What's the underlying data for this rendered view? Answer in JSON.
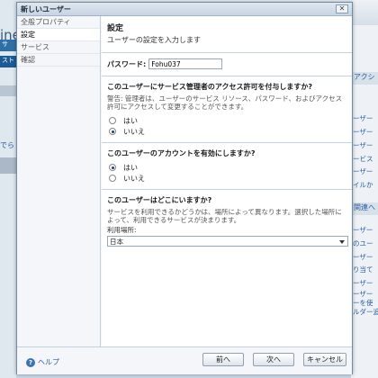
{
  "background": {
    "brand_fragment": "ine",
    "nav1_fragment": "サ",
    "nav2_fragment": "スト",
    "link_fragment": "でら",
    "right_header": "アクシ",
    "right_header2": "関連へ",
    "right_links": [
      "ーザー",
      "ーザー",
      "ーザー",
      "ービス",
      "ーザー",
      "イルか"
    ],
    "right_links2": [
      "ーザー",
      "のユー",
      "ーザー",
      "り当て",
      "ーザー",
      "ーザー",
      "ーを使",
      "ルダー追"
    ]
  },
  "dialog": {
    "title": "新しいユーザー",
    "close_label": "✕"
  },
  "sidebar": {
    "items": [
      {
        "label": "全般プロパティ"
      },
      {
        "label": "設定"
      },
      {
        "label": "サービス"
      },
      {
        "label": "確認"
      }
    ]
  },
  "content": {
    "title": "設定",
    "subtitle": "ユーザーの設定を入力します",
    "password_label": "パスワード:",
    "password_value": "Fohu037",
    "admin_question": "このユーザーにサービス管理者のアクセス許可を付与しますか?",
    "admin_warning": "警告: 管理者は、ユーザーのサービス リソース、パスワード、およびアクセス許可にアクセスして変更することができます。",
    "admin_yes": "はい",
    "admin_no": "いいえ",
    "enable_question": "このユーザーのアカウントを有効にしますか?",
    "enable_yes": "はい",
    "enable_no": "いいえ",
    "location_question": "このユーザーはどこにいますか?",
    "location_note": "サービスを利用できるかどうかは、場所によって異なります。選択した場所によって、利用できるサービスが決まります。",
    "location_label": "利用場所:",
    "location_value": "日本"
  },
  "footer": {
    "help_label": "ヘルプ",
    "back_label": "前へ",
    "next_label": "次へ",
    "cancel_label": "キャンセル"
  },
  "colors": {
    "accent": "#2a5ea0",
    "dialog_border": "#6e8ba8"
  }
}
